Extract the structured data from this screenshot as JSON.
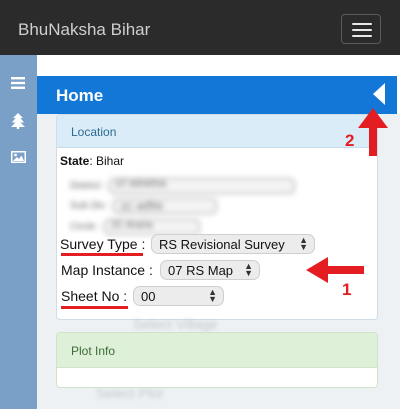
{
  "app": {
    "title": "BhuNaksha Bihar"
  },
  "header": {
    "title": "Home"
  },
  "location": {
    "title": "Location",
    "state_label": "State",
    "state_value": ": Bihar",
    "blurred": [
      {
        "label": "District :",
        "value": "07 ARARIA"
      },
      {
        "label": "Sub Div :",
        "value": "2C अररिया"
      },
      {
        "label": "Circle :",
        "value": "2C Araria"
      }
    ],
    "survey_type": {
      "label": "Survey Type :",
      "value": "RS Revisional Survey"
    },
    "map_instance": {
      "label": "Map Instance :",
      "value": "07 RS Map"
    },
    "sheet_no": {
      "label": "Sheet No :",
      "value": "00"
    }
  },
  "faint_text": {
    "line1": "Select Village",
    "line2": "Select Plot"
  },
  "plot_info": {
    "title": "Plot Info"
  },
  "annotations": {
    "one": "1",
    "two": "2"
  },
  "icons": {
    "sidebar": [
      "menu-icon",
      "tree-icon",
      "image-icon"
    ],
    "collapse": "caret-left-icon"
  },
  "colors": {
    "navbar": "#2b2b2b",
    "sidebar": "#7aa0c8",
    "header": "#1277d6",
    "annotation": "#e41d23",
    "location_heading": "#d9ecf8",
    "plot_info_heading": "#dff0d8"
  }
}
